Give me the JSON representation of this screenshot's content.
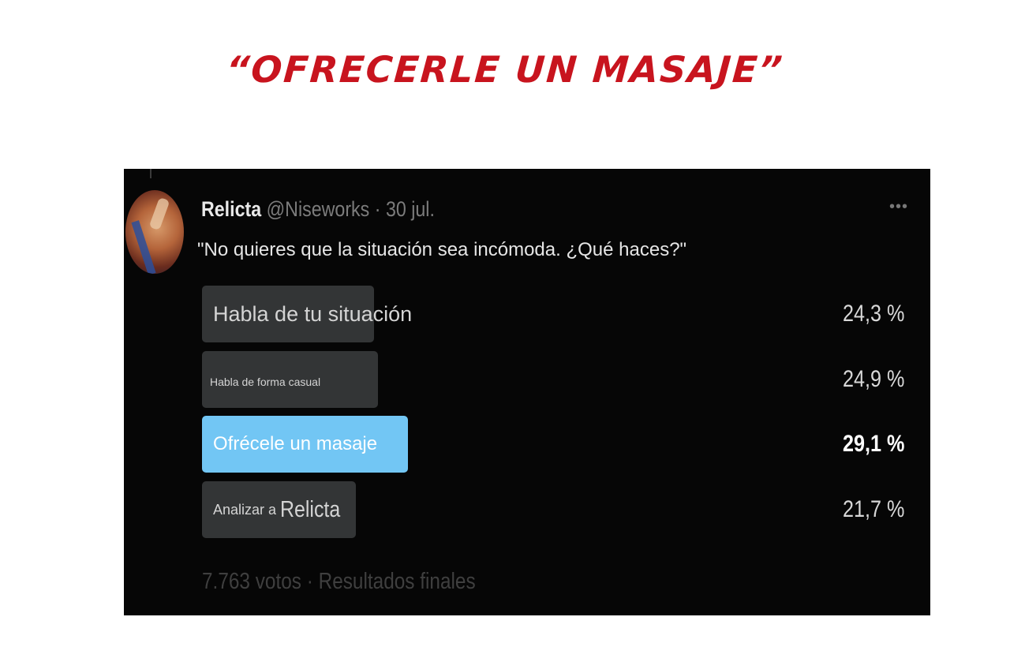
{
  "headline": "“OFRECERLE UN MASAJE”",
  "tweet": {
    "author_name": "Relicta",
    "author_handle": "@Niseworks",
    "separator": "·",
    "date": "30 jul.",
    "more_icon": "more-horizontal-icon",
    "text": "\"No quieres que la situación sea incómoda. ¿Qué haces?\""
  },
  "poll": {
    "options": [
      {
        "label": "Habla de tu situación",
        "percent_text": "24,3 %",
        "percent": 24.3,
        "winner": false
      },
      {
        "label": "Habla de forma casual",
        "percent_text": "24,9 %",
        "percent": 24.9,
        "winner": false
      },
      {
        "label": "Ofrécele un masaje",
        "percent_text": "29,1 %",
        "percent": 29.1,
        "winner": true
      },
      {
        "label_prefix": "Analizar a",
        "label_name": "Relicta",
        "percent_text": "21,7 %",
        "percent": 21.7,
        "winner": false
      }
    ],
    "footer": "7.763 votos · Resultados finales"
  },
  "colors": {
    "headline": "#c8141e",
    "background": "#060606",
    "bar": "#333536",
    "winner_bar": "#72c6f4"
  }
}
